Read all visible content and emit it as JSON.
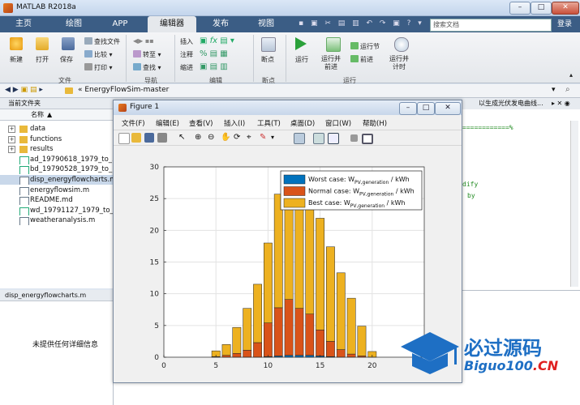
{
  "app": {
    "title": "MATLAB R2018a",
    "window_buttons": {
      "minimize": "–",
      "maximize": "□",
      "close": "✕"
    }
  },
  "tabs": [
    {
      "label": "主页",
      "active": false
    },
    {
      "label": "绘图",
      "active": false
    },
    {
      "label": "APP",
      "active": false
    },
    {
      "label": "编辑器",
      "active": true
    },
    {
      "label": "发布",
      "active": false
    },
    {
      "label": "视图",
      "active": false
    }
  ],
  "search": {
    "placeholder": "搜索文档"
  },
  "login_label": "登录",
  "ribbon": {
    "file": {
      "new": "新建",
      "open": "打开",
      "save": "保存",
      "find_files": "查找文件",
      "compare": "比较",
      "print": "打印",
      "group": "文件"
    },
    "navigate": {
      "goto": "转至",
      "find": "查找",
      "group": "导航"
    },
    "edit": {
      "insert": "插入",
      "comment": "注释",
      "indent": "缩进",
      "group": "编辑"
    },
    "breakpoints": {
      "breakpoints": "断点",
      "group": "断点"
    },
    "run": {
      "run": "运行",
      "run_advance": "运行并\n前进",
      "run_section": "运行节",
      "advance": "前进",
      "run_time": "运行并\n计时",
      "group": "运行"
    }
  },
  "address": {
    "path": "« EnergyFlowSim-master"
  },
  "current_folder": {
    "title": "当前文件夹",
    "column": "名称",
    "items": [
      {
        "name": "data",
        "type": "folder"
      },
      {
        "name": "functions",
        "type": "folder"
      },
      {
        "name": "results",
        "type": "folder"
      },
      {
        "name": "ad_19790618_1979_to_...",
        "type": "script"
      },
      {
        "name": "bd_19790528_1979_to_...",
        "type": "script"
      },
      {
        "name": "disp_energyflowcharts.m",
        "type": "mfile",
        "selected": true
      },
      {
        "name": "energyflowsim.m",
        "type": "mfile"
      },
      {
        "name": "README.md",
        "type": "doc"
      },
      {
        "name": "wd_19791127_1979_to_...",
        "type": "script"
      },
      {
        "name": "weatheranalysis.m",
        "type": "mfile"
      }
    ]
  },
  "details": {
    "file": "disp_energyflowcharts.m",
    "empty_text": "未提供任何详细信息"
  },
  "editor": {
    "tab": "以生成光伏发电曲线...",
    "line1": "============%",
    "line2": "dify",
    "line3": "by"
  },
  "figure": {
    "title": "Figure 1",
    "menu": [
      "文件(F)",
      "编辑(E)",
      "查看(V)",
      "插入(I)",
      "工具(T)",
      "桌面(D)",
      "窗口(W)",
      "帮助(H)"
    ]
  },
  "chart_data": {
    "type": "bar",
    "stacked": true,
    "x": [
      1,
      2,
      3,
      4,
      5,
      6,
      7,
      8,
      9,
      10,
      11,
      12,
      13,
      14,
      15,
      16,
      17,
      18,
      19,
      20,
      21,
      22,
      23,
      24
    ],
    "series": [
      {
        "name": "Worst case: W_PV,generation / kWh",
        "color": "#0072bd",
        "values": [
          0,
          0,
          0,
          0,
          0,
          0,
          0,
          0,
          0,
          0.1,
          0.2,
          0.3,
          0.3,
          0.3,
          0.2,
          0.1,
          0,
          0,
          0,
          0,
          0,
          0,
          0,
          0
        ]
      },
      {
        "name": "Normal case: W_PV,generation / kWh",
        "color": "#d95319",
        "values": [
          0,
          0,
          0,
          0,
          0.1,
          0.3,
          0.6,
          1.1,
          2.3,
          5.3,
          7.6,
          8.8,
          7.4,
          6.5,
          4.1,
          2.4,
          1.2,
          0.5,
          0.2,
          0,
          0,
          0,
          0,
          0
        ]
      },
      {
        "name": "Best case: W_PV,generation / kWh",
        "color": "#edb120",
        "values": [
          0,
          0,
          0,
          0,
          0.9,
          1.7,
          4.1,
          6.6,
          9.2,
          12.6,
          17.9,
          16.8,
          17.9,
          16.9,
          17.6,
          14.9,
          12.1,
          8.8,
          4.7,
          0.9,
          0,
          0,
          0,
          0
        ]
      }
    ],
    "xlim": [
      0,
      25
    ],
    "ylim": [
      0,
      30
    ],
    "xticks": [
      0,
      5,
      10,
      15,
      20
    ],
    "yticks": [
      0,
      5,
      10,
      15,
      20,
      25,
      30
    ],
    "grid": true,
    "legend": "top-right",
    "legend_labels": [
      {
        "main": "Worst case: W",
        "sub": "PV,generation",
        "unit": " / kWh"
      },
      {
        "main": "Normal case: W",
        "sub": "PV,generation",
        "unit": " / kWh"
      },
      {
        "main": "Best case: W",
        "sub": "PV,generation",
        "unit": " / kWh"
      }
    ]
  },
  "watermark": {
    "chinese": "必过源码",
    "domain": "Biguo100",
    "tld": ".CN"
  },
  "colors": {
    "tabbar": "#3b5d85",
    "accent": "#0072bd"
  }
}
